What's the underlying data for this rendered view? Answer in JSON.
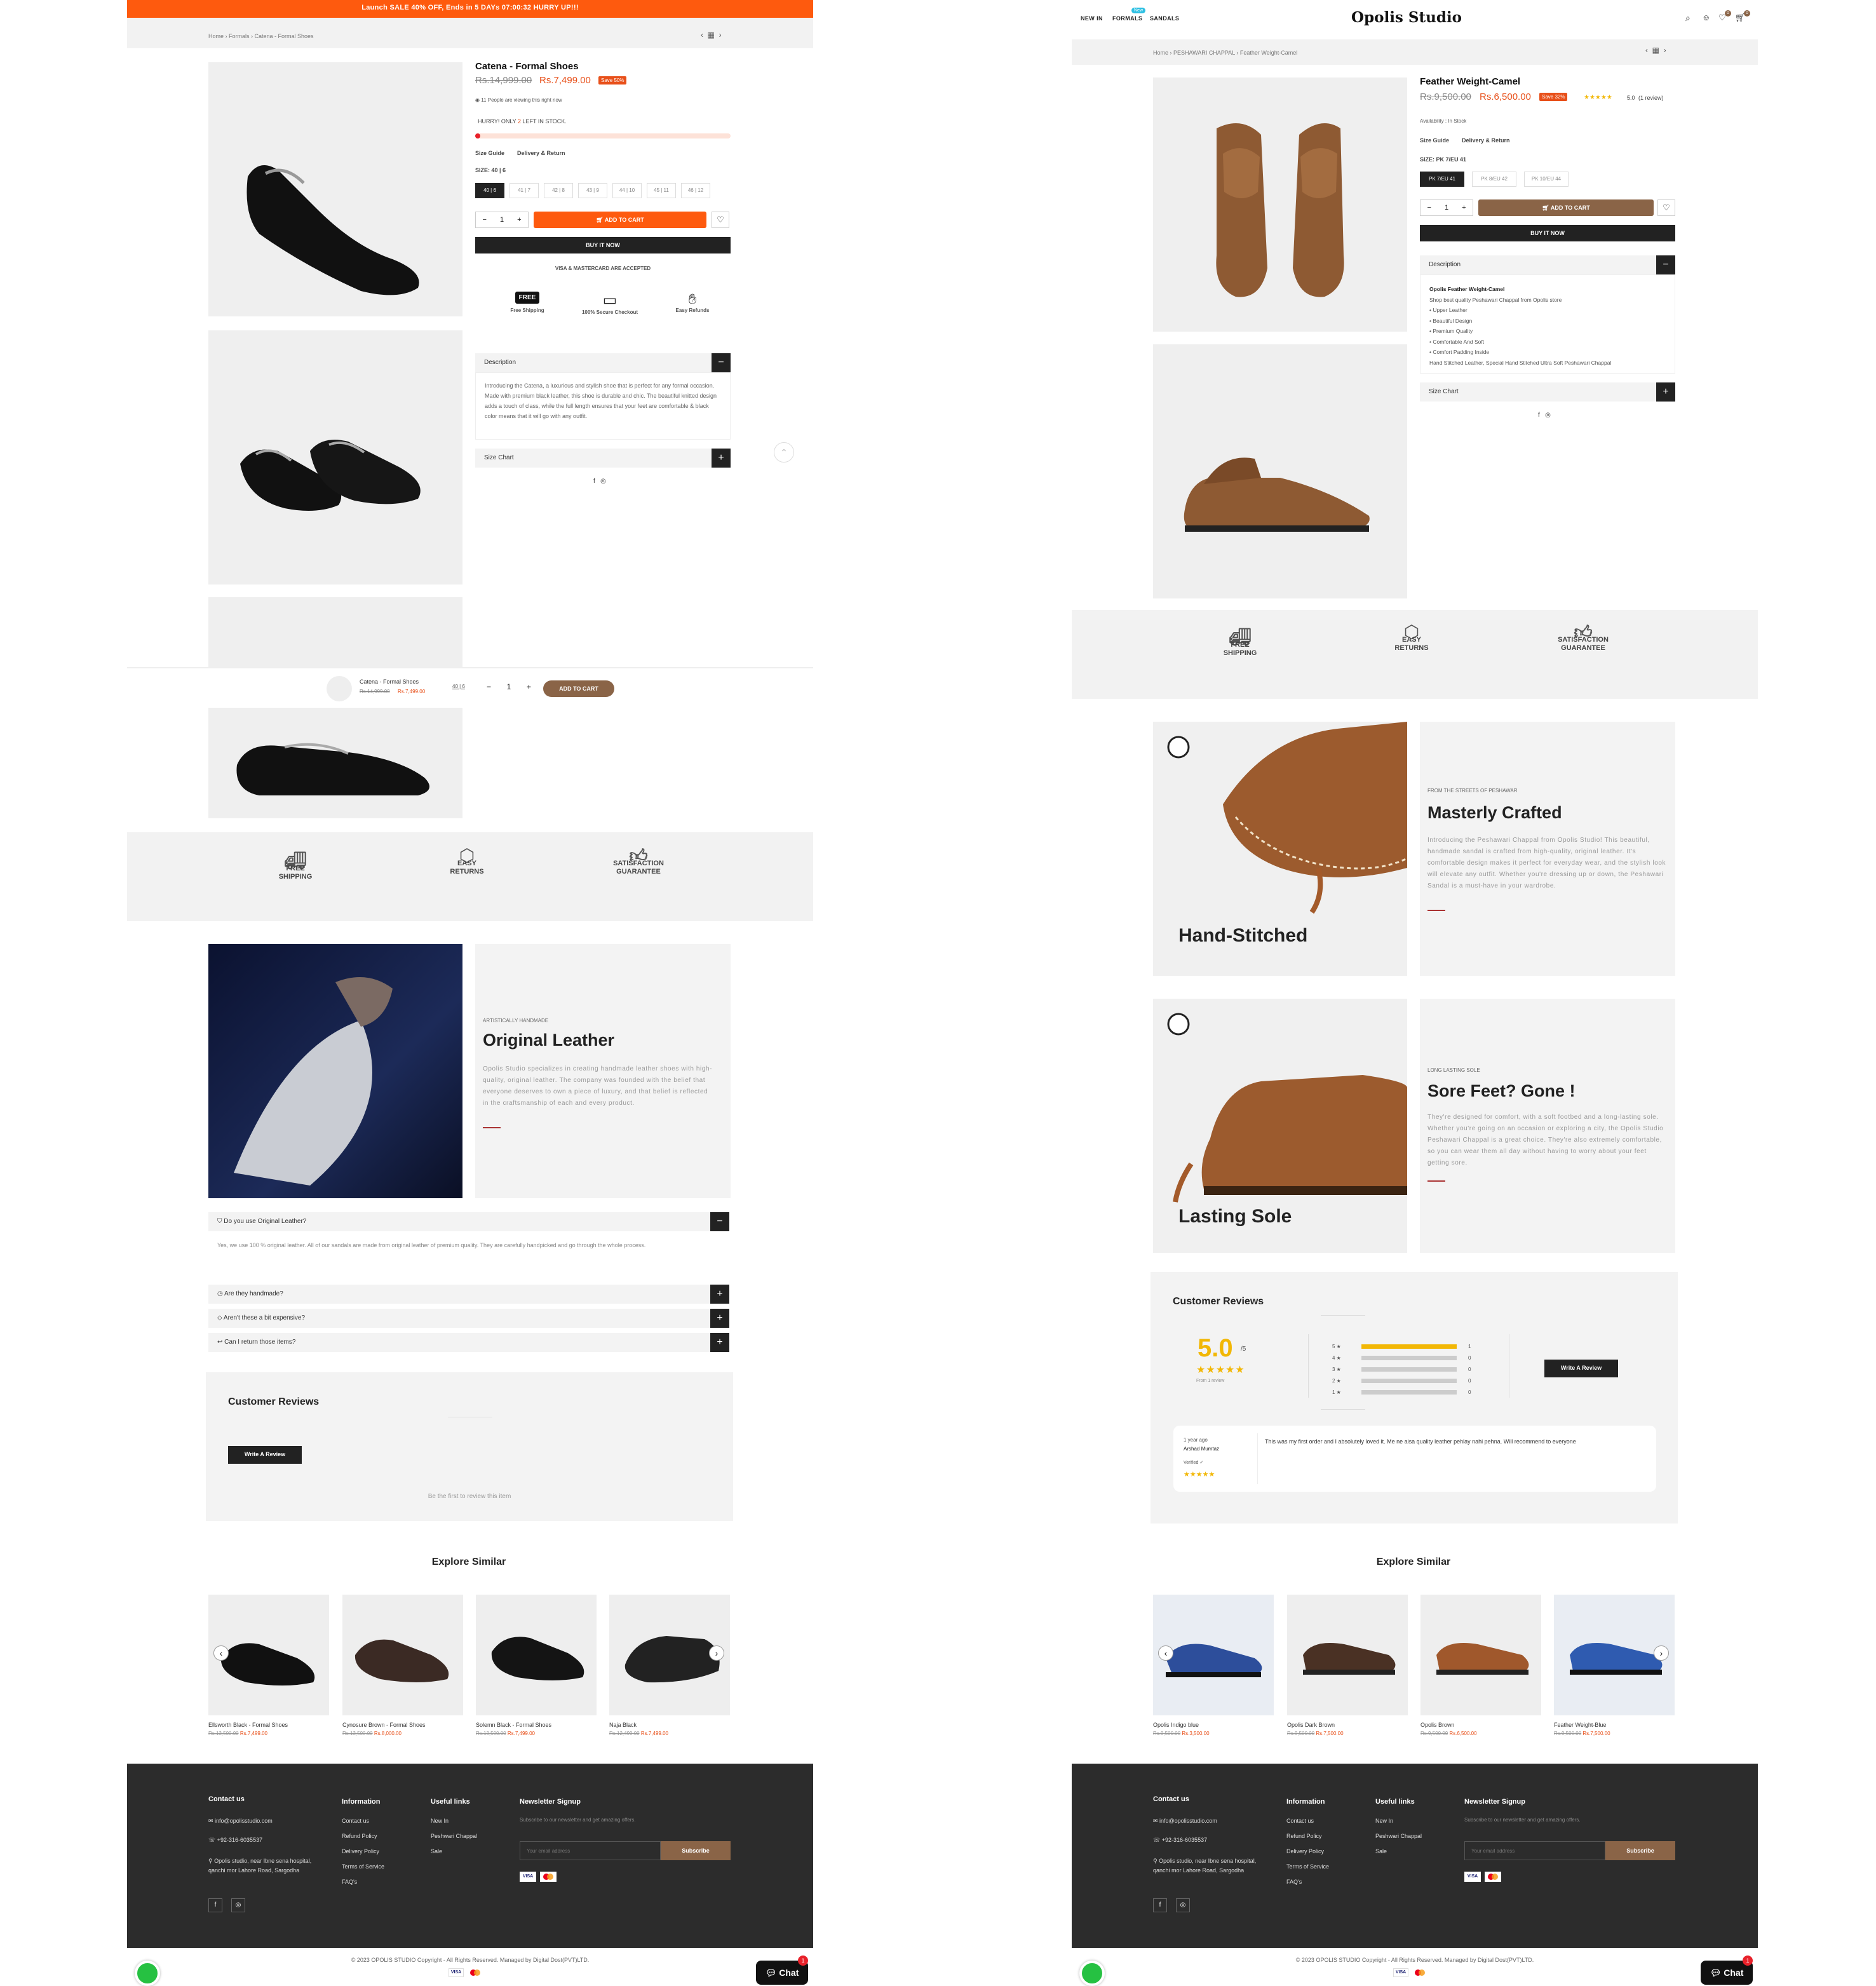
{
  "left": {
    "announcement": "Launch SALE 40% OFF, Ends in 5 DAYs 07:00:32 HURRY UP!!!",
    "breadcrumb": "Home  ›  Formals  ›  Catena - Formal Shoes",
    "product": {
      "title": "Catena - Formal Shoes",
      "old_price": "Rs.14,999.00",
      "new_price": "Rs.7,499.00",
      "save": "Save 50%",
      "viewing": "11 People are viewing this right now",
      "hurry_prefix": "HURRY! ONLY ",
      "hurry_count": "2",
      "hurry_suffix": " LEFT IN STOCK.",
      "size_guide": "Size Guide",
      "delivery": "Delivery & Return",
      "size_label": "SIZE: 40 | 6",
      "sizes": [
        "40 | 6",
        "41 | 7",
        "42 | 8",
        "43 | 9",
        "44 | 10",
        "45 | 11",
        "46 | 12"
      ],
      "qty": "1",
      "add_to_cart": "ADD TO CART",
      "buy_now": "BUY IT NOW",
      "visa_note": "VISA & MASTERCARD ARE ACCEPTED",
      "badges": [
        "Free Shipping",
        "100% Secure Checkout",
        "Easy Refunds"
      ],
      "badge_free_text": "FREE",
      "description_label": "Description",
      "description": "Introducing the Catena, a luxurious and stylish shoe that is perfect for any formal occasion. Made with premium black leather, this shoe is durable and chic. The beautiful knitted design adds a touch of class, while the full length ensures that your feet are comfortable & black color means that it will go with any outfit.",
      "size_chart": "Size Chart"
    },
    "sticky": {
      "name": "Catena - Formal Shoes",
      "old_price": "Rs.14,999.00",
      "new_price": "Rs.7,499.00",
      "size": "40 | 6",
      "qty": "1",
      "button": "ADD TO CART"
    },
    "benefits": [
      "FREE\nSHIPPING",
      "EASY\nRETURNS",
      "SATISFACTION\nGUARANTEE"
    ],
    "feature": {
      "kicker": "ARTISTICALLY HANDMADE",
      "title": "Original Leather",
      "body": "Opolis Studio specializes in creating handmade leather shoes with high-quality, original leather. The company was founded with the belief that everyone deserves to own a piece of luxury, and that belief is reflected in the craftsmanship of each and every product."
    },
    "faq": [
      {
        "q": "Do you use Original Leather?",
        "a": "Yes, we use 100 % original leather. All of our sandals are made from original leather of premium quality. They are carefully handpicked and go through the whole process."
      },
      {
        "q": "Are they handmade?"
      },
      {
        "q": "Aren't these a bit expensive?"
      },
      {
        "q": "Can I return those items?"
      }
    ],
    "reviews": {
      "title": "Customer Reviews",
      "write": "Write A Review",
      "empty": "Be the first to review this item"
    },
    "similar": {
      "title": "Explore Similar",
      "items": [
        {
          "name": "Ellsworth Black - Formal Shoes",
          "old": "Rs.13,500.00",
          "new": "Rs.7,499.00"
        },
        {
          "name": "Cynosure Brown - Formal Shoes",
          "old": "Rs.13,500.00",
          "new": "Rs.8,000.00"
        },
        {
          "name": "Solemn Black - Formal Shoes",
          "old": "Rs.13,500.00",
          "new": "Rs.7,499.00"
        },
        {
          "name": "Naja Black",
          "old": "Rs.12,499.00",
          "new": "Rs.7,499.00"
        }
      ]
    }
  },
  "right": {
    "nav": [
      "NEW IN",
      "FORMALS",
      "SANDALS"
    ],
    "nav_badge": "New",
    "logo": "Opolis Studio",
    "wishlist_count": "0",
    "cart_count": "0",
    "breadcrumb": "Home  ›  PESHAWARI CHAPPAL  ›  Feather Weight-Camel",
    "product": {
      "title": "Feather Weight-Camel",
      "old_price": "Rs.9,500.00",
      "new_price": "Rs.6,500.00",
      "save": "Save 32%",
      "rating": "5.0",
      "rating_count": "(1 review)",
      "availability": "Availability : In Stock",
      "size_guide": "Size Guide",
      "delivery": "Delivery & Return",
      "size_label": "SIZE: PK 7/EU 41",
      "sizes": [
        "PK 7/EU 41",
        "PK 8/EU 42",
        "PK 10/EU 44"
      ],
      "qty": "1",
      "add_to_cart": "ADD TO CART",
      "buy_now": "BUY IT NOW",
      "description_label": "Description",
      "desc_title": "Opolis Feather Weight-Camel",
      "desc_lines": [
        "Shop best quality Peshawari Chappal from Opolis store",
        "• Upper Leather",
        "• Beautiful Design",
        "• Premium Quality",
        "• Comfortable And Soft",
        "• Comfort Padding Inside",
        "Hand Stitched Leather, Special Hand Stitched Ultra Soft Peshawari Chappal"
      ],
      "size_chart": "Size Chart"
    },
    "benefits": [
      "FREE\nSHIPPING",
      "EASY\nRETURNS",
      "SATISFACTION\nGUARANTEE"
    ],
    "feature1": {
      "label": "Hand-Stitched",
      "kicker": "FROM THE STREETS OF PESHAWAR",
      "title": "Masterly Crafted",
      "body": "Introducing the Peshawari Chappal from Opolis Studio! This beautiful, handmade sandal is crafted from high-quality, original leather. It's comfortable design makes it perfect for everyday wear, and the stylish look will elevate any outfit. Whether you're dressing up or down, the Peshawari Sandal is a must-have in your wardrobe."
    },
    "feature2": {
      "label": "Lasting Sole",
      "kicker": "LONG LASTING SOLE",
      "title": "Sore Feet? Gone !",
      "body": "They're designed for comfort, with a soft footbed and a long-lasting sole. Whether you're going on an occasion or exploring a city, the Opolis Studio Peshawari Chappal is a great choice. They're also extremely comfortable, so you can wear them all day without having to worry about your feet getting sore."
    },
    "reviews": {
      "title": "Customer Reviews",
      "score": "5.0",
      "out_of": "/5",
      "from": "From 1 review",
      "bars": [
        {
          "star": "5",
          "count": "1",
          "fill": 1.0
        },
        {
          "star": "4",
          "count": "0",
          "fill": 0
        },
        {
          "star": "3",
          "count": "0",
          "fill": 0
        },
        {
          "star": "2",
          "count": "0",
          "fill": 0
        },
        {
          "star": "1",
          "count": "0",
          "fill": 0
        }
      ],
      "write": "Write A Review",
      "review": {
        "when": "1 year ago",
        "author": "Arshad Mumtaz",
        "verified": "Verified",
        "text": "This was my first order and I absolutely loved it. Me ne aisa quality leather pehlay nahi pehna. Will recommend to everyone"
      }
    },
    "similar": {
      "title": "Explore Similar",
      "items": [
        {
          "name": "Opolis Indigo blue",
          "old": "Rs.9,500.00",
          "new": "Rs.3,500.00"
        },
        {
          "name": "Opolis Dark Brown",
          "old": "Rs.9,500.00",
          "new": "Rs.7,500.00"
        },
        {
          "name": "Opolis Brown",
          "old": "Rs.9,500.00",
          "new": "Rs.6,500.00"
        },
        {
          "name": "Feather Weight-Blue",
          "old": "Rs.9,500.00",
          "new": "Rs.7,500.00"
        }
      ]
    }
  },
  "footer": {
    "contact_title": "Contact us",
    "email": "info@opolisstudio.com",
    "phone": "+92-316-6035537",
    "address": "Opolis studio, near Ibne sena hospital, qanchi mor Lahore Road, Sargodha",
    "info_title": "Information",
    "info_links": [
      "Contact us",
      "Refund Policy",
      "Delivery Policy",
      "Terms of Service",
      "FAQ's"
    ],
    "useful_title": "Useful links",
    "useful_links": [
      "New In",
      "Peshwari Chappal",
      "Sale"
    ],
    "newsletter_title": "Newsletter Signup",
    "newsletter_text": "Subscribe to our newsletter and get amazing offers.",
    "email_placeholder": "Your email address",
    "subscribe": "Subscribe",
    "copyright": "© 2023 OPOLIS STUDIO Copyright - All Rights Reserved. Managed by Digital Dost(PVT)LTD.",
    "chat": "Chat",
    "chat_count": "1",
    "visa": "VISA"
  },
  "colors": {
    "accent_orange": "#fe5a0e",
    "brown": "#8a6447",
    "dark": "#2c2c2c",
    "star": "#f2b705"
  }
}
